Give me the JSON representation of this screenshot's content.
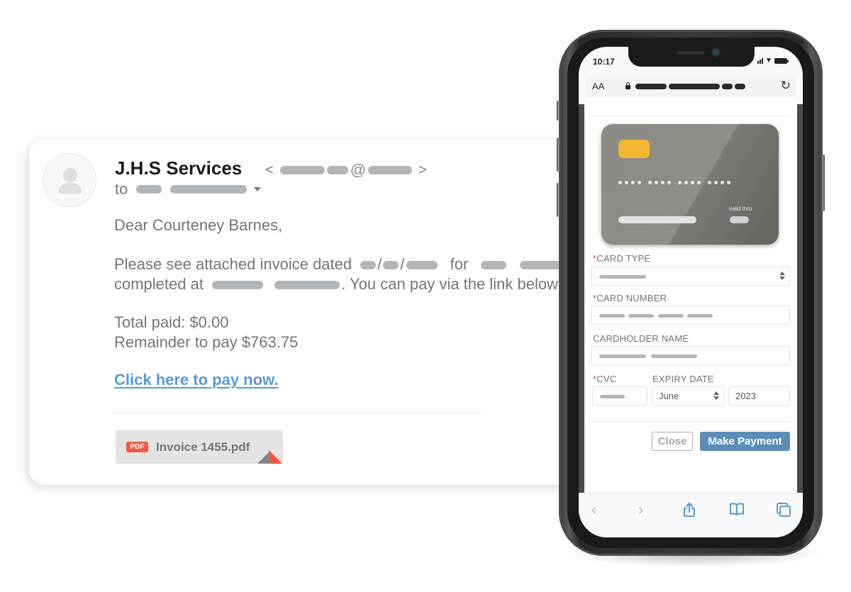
{
  "email": {
    "sender_name": "J.H.S Services",
    "sender_email_open": "<",
    "sender_email_at": "@",
    "sender_email_close": ">",
    "to_label": "to",
    "greeting": "Dear Courteney Barnes,",
    "para_line1_prefix": "Please see attached invoice dated",
    "para_date_sep": "/",
    "para_line1_for": "for",
    "para_line2_prefix": "completed at",
    "para_line2_suffix": ". You can pay via the link below",
    "total_paid": "Total paid: $0.00",
    "remainder": "Remainder to pay $763.75",
    "pay_link": "Click here to pay now.",
    "attachment": {
      "badge": "PDF",
      "filename": "Invoice 1455.pdf"
    }
  },
  "phone": {
    "status_time": "10:17",
    "url_bar": {
      "text_size_label": "AA"
    },
    "card_preview": {
      "valid_thru_label": "valid thru"
    },
    "form": {
      "card_type_label": "CARD TYPE",
      "card_number_label": "CARD NUMBER",
      "cardholder_name_label": "CARDHOLDER NAME",
      "cvc_label": "CVC",
      "expiry_label": "EXPIRY DATE",
      "required_mark": "*",
      "expiry_month": "June",
      "expiry_year": "2023",
      "close_button": "Close",
      "pay_button": "Make Payment"
    },
    "toolbar": {
      "back_glyph": "‹",
      "forward_glyph": "›"
    }
  },
  "colors": {
    "link": "#5a9bd0",
    "pay_button": "#5b8db8",
    "required": "#e74c3c",
    "pdf_badge": "#ef5b45",
    "chip": "#f2b632",
    "toolbar_icon": "#5a9bd0"
  }
}
